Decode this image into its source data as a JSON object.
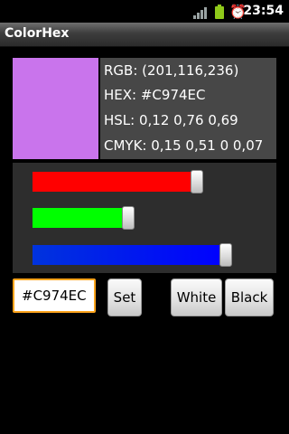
{
  "status_bar": {
    "time": "23:54",
    "icons": [
      "signal-icon",
      "battery-icon",
      "alarm-icon"
    ]
  },
  "app": {
    "title": "ColorHex"
  },
  "color": {
    "swatch_color": "#C974EC",
    "rgb_text": "RGB: (201,116,236)",
    "hex_text": "HEX: #C974EC",
    "hsl_text": "HSL: 0,12 0,76 0,69",
    "cmyk_text": "CMYK: 0,15 0,51 0 0,07"
  },
  "sliders": [
    {
      "name": "red",
      "value": 201,
      "max": 255,
      "color": "#ff0000"
    },
    {
      "name": "green",
      "value": 116,
      "max": 255,
      "color": "#00ff00"
    },
    {
      "name": "blue",
      "value": 236,
      "max": 255,
      "color": "#0000ff"
    }
  ],
  "controls": {
    "hex_input_value": "#C974EC",
    "set_label": "Set",
    "white_label": "White",
    "black_label": "Black"
  }
}
